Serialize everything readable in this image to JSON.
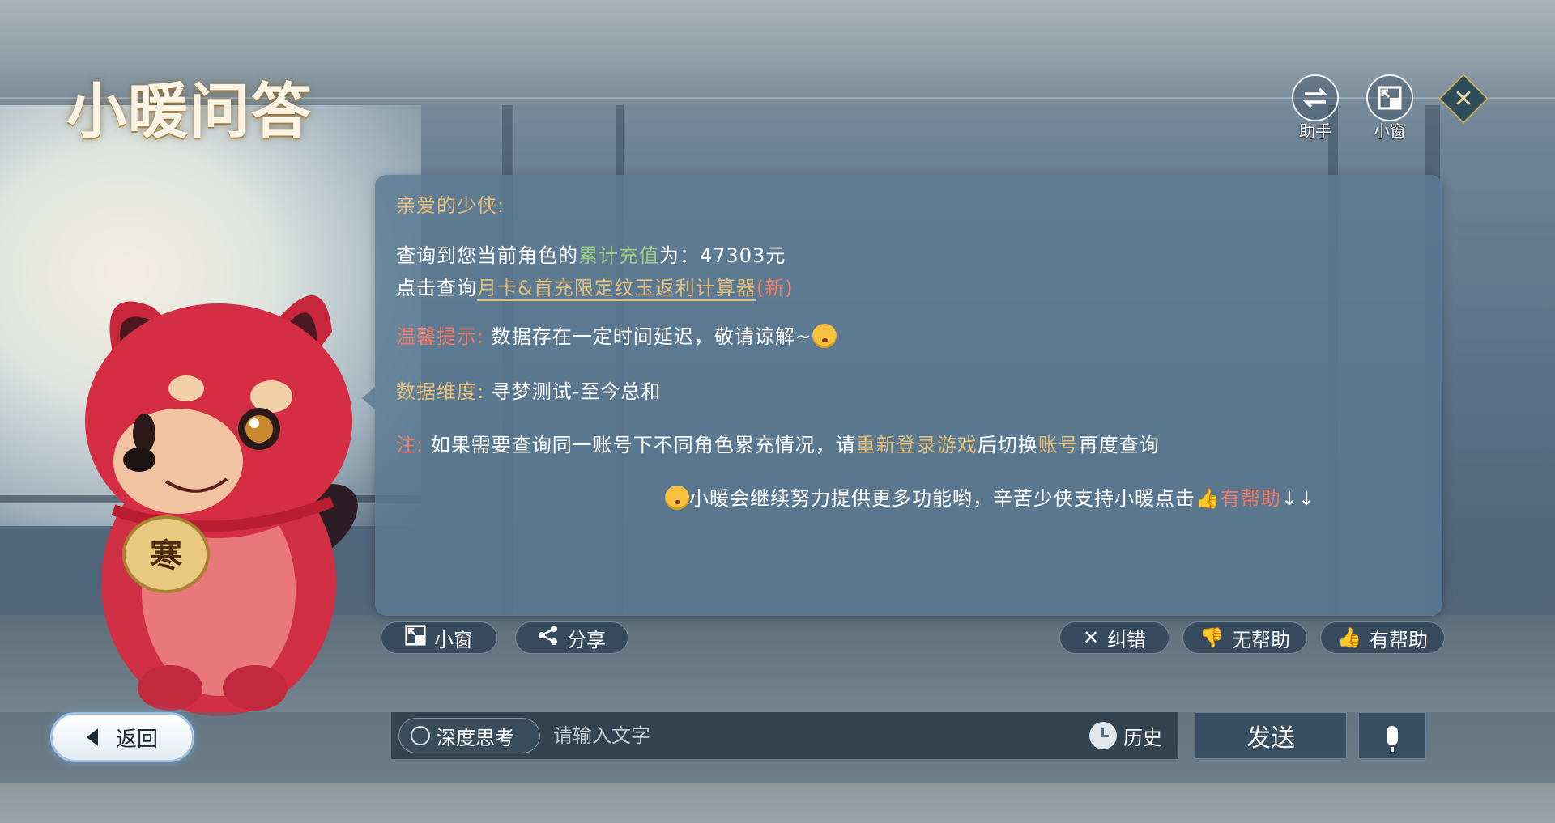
{
  "header": {
    "title": "小暖问答",
    "assistant_label": "助手",
    "mini_window_label": "小窗"
  },
  "message": {
    "greeting": "亲爱的少侠:",
    "line1_prefix": "查询到您当前角色的",
    "line1_highlight": "累计充值",
    "line1_suffix": "为：47303元",
    "line2_prefix": "点击查询",
    "line2_link": "月卡&首充限定纹玉返利计算器",
    "line2_new": "(新)",
    "tip_label": "温馨提示:",
    "tip_text": "数据存在一定时间延迟，敬请谅解~",
    "dimension_label": "数据维度:",
    "dimension_text": "寻梦测试-至今总和",
    "note_label": "注:",
    "note_part1": "如果需要查询同一账号下不同角色累充情况，请",
    "note_highlight1": "重新登录游戏",
    "note_part2": "后切换",
    "note_highlight2": "账号",
    "note_part3": "再度查询",
    "footer_text": "小暖会继续努力提供更多功能哟，辛苦少侠支持小暖点击",
    "footer_highlight": "有帮助",
    "footer_arrows": "↓↓"
  },
  "actions": {
    "mini_window": "小窗",
    "share": "分享",
    "correct": "纠错",
    "not_helpful": "无帮助",
    "helpful": "有帮助"
  },
  "bottom": {
    "back": "返回",
    "deep_think": "深度思考",
    "input_placeholder": "请输入文字",
    "history": "历史",
    "send": "发送"
  },
  "mascot": {
    "collar_tag": "寒"
  },
  "colors": {
    "gold": "#e4bf7a",
    "green": "#9ccf86",
    "red": "#f07a6a",
    "dialog_bg": "#5c7a93"
  }
}
